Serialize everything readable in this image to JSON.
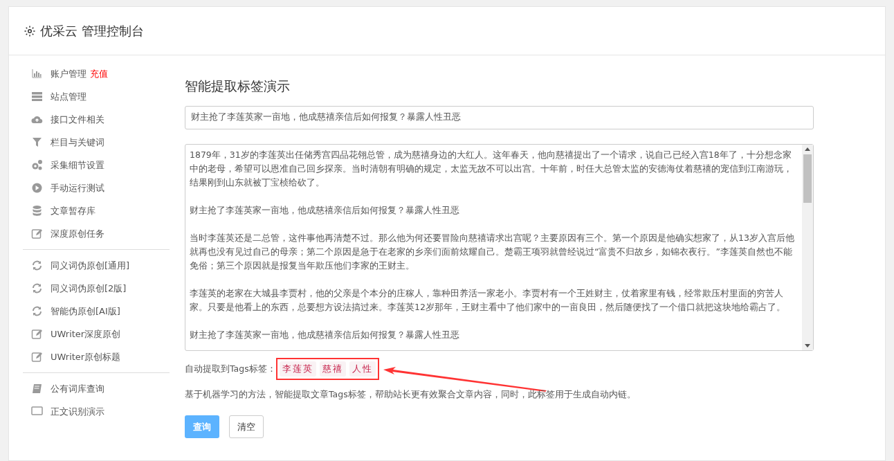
{
  "header": {
    "title": "优采云 管理控制台"
  },
  "sidebar": {
    "groups": [
      {
        "items": [
          {
            "label": "账户管理",
            "badge": "充值"
          },
          {
            "label": "站点管理"
          },
          {
            "label": "接口文件相关"
          },
          {
            "label": "栏目与关键词"
          },
          {
            "label": "采集细节设置"
          },
          {
            "label": "手动运行测试"
          },
          {
            "label": "文章暂存库"
          },
          {
            "label": "深度原创任务"
          }
        ]
      },
      {
        "items": [
          {
            "label": "同义词伪原创[通用]"
          },
          {
            "label": "同义词伪原创[2版]"
          },
          {
            "label": "智能伪原创[AI版]"
          },
          {
            "label": "UWriter深度原创"
          },
          {
            "label": "UWriter原创标题"
          }
        ]
      },
      {
        "items": [
          {
            "label": "公有词库查询"
          },
          {
            "label": "正文识别演示"
          }
        ]
      }
    ]
  },
  "main": {
    "title": "智能提取标签演示",
    "title_field": {
      "value": "财主抢了李莲英家一亩地，他成慈禧亲信后如何报复？暴露人性丑恶"
    },
    "content_paragraphs": [
      "1879年，31岁的李莲英出任储秀宫四品花翎总管，成为慈禧身边的大红人。这年春天，他向慈禧提出了一个请求，说自己已经入宫18年了，十分想念家中的老母，希望可以恩准自己回乡探亲。当时清朝有明确的规定，太监无故不可以出宫。十年前，时任大总管太监的安德海仗着慈禧的宠信到江南游玩，结果刚到山东就被丁宝桢给砍了。",
      "财主抢了李莲英家一亩地，他成慈禧亲信后如何报复？暴露人性丑恶",
      "当时李莲英还是二总管，这件事他再清楚不过。那么他为何还要冒险向慈禧请求出宫呢？主要原因有三个。第一个原因是他确实想家了，从13岁入宫后他就再也没有见过自己的母亲；第二个原因是急于在老家的乡亲们面前炫耀自己。楚霸王项羽就曾经说过“富贵不归故乡，如锦衣夜行。”李莲英自然也不能免俗；第三个原因就是报复当年欺压他们李家的王财主。",
      "李莲英的老家在大城县李贾村，他的父亲是个本分的庄稼人，靠种田养活一家老小。李贾村有一个王姓财主，仗着家里有钱，经常欺压村里面的穷苦人家。只要是他看上的东西，总要想方设法搞过来。李莲英12岁那年，王财主看中了他们家中的一亩良田，然后随便找了一个借口就把这块地给霸占了。",
      "财主抢了李莲英家一亩地，他成慈禧亲信后如何报复？暴露人性丑恶"
    ],
    "tags_label": "自动提取到Tags标签：",
    "tags": [
      "李莲英",
      "慈禧",
      "人性"
    ],
    "tags_highlighted": true,
    "description": "基于机器学习的方法，智能提取文章Tags标签，帮助站长更有效聚合文章内容，同时，此标签用于生成自动内链。",
    "buttons": [
      {
        "label": "查询",
        "kind": "primary"
      },
      {
        "label": "清空",
        "kind": "default"
      }
    ]
  }
}
